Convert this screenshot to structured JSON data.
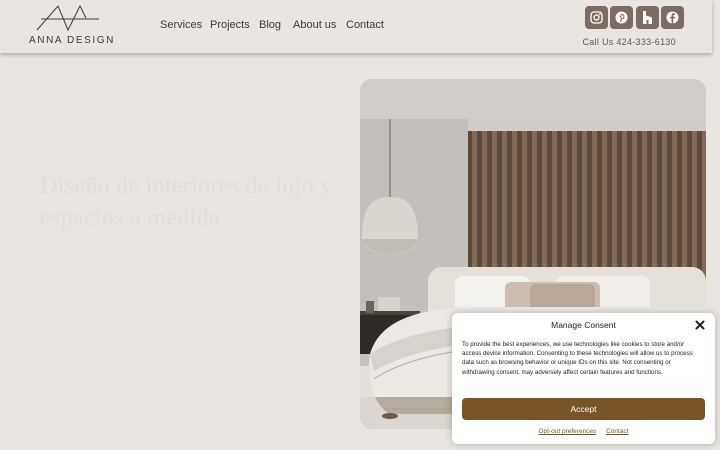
{
  "brand": {
    "name": "ANNA DESIGN"
  },
  "nav": {
    "items": [
      {
        "label": "Services"
      },
      {
        "label": "Projects"
      },
      {
        "label": "Blog"
      },
      {
        "label": "About us"
      },
      {
        "label": "Contact"
      }
    ]
  },
  "social": {
    "icons": [
      "instagram-icon",
      "pinterest-icon",
      "houzz-icon",
      "facebook-icon"
    ],
    "color": "#7d6a60"
  },
  "contact": {
    "phone": "Call Us 424-333-6130"
  },
  "hero": {
    "heading": "Diseño de interiores de lujo y espacios a medida"
  },
  "consent": {
    "title": "Manage Consent",
    "body": "To provide the best experiences, we use technologies like cookies to store and/or access device information. Consenting to these technologies will allow us to process data such as browsing behavior or unique IDs on this site. Not consenting or withdrawing consent, may adversely affect certain features and functions.",
    "accept_label": "Accept",
    "optout_label": "Opt-out preferences",
    "contact_label": "Contact",
    "accent_color": "#7a5426"
  }
}
